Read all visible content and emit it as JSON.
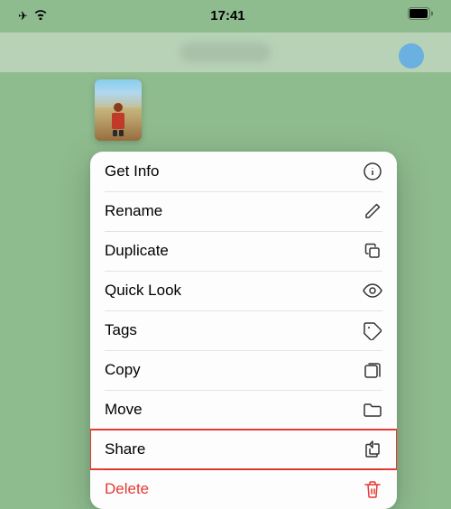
{
  "statusBar": {
    "time": "17:41",
    "signal": "✈",
    "wifi": "wifi",
    "battery": "battery"
  },
  "menu": {
    "items": [
      {
        "id": "get-info",
        "label": "Get Info",
        "icon": "info"
      },
      {
        "id": "rename",
        "label": "Rename",
        "icon": "pencil"
      },
      {
        "id": "duplicate",
        "label": "Duplicate",
        "icon": "duplicate"
      },
      {
        "id": "quick-look",
        "label": "Quick Look",
        "icon": "eye"
      },
      {
        "id": "tags",
        "label": "Tags",
        "icon": "tag"
      },
      {
        "id": "copy",
        "label": "Copy",
        "icon": "copy"
      },
      {
        "id": "move",
        "label": "Move",
        "icon": "folder"
      },
      {
        "id": "share",
        "label": "Share",
        "icon": "share",
        "highlighted": true
      },
      {
        "id": "delete",
        "label": "Delete",
        "icon": "trash",
        "destructive": true
      }
    ]
  },
  "colors": {
    "accent": "#e53935",
    "background": "#8fbc8f",
    "menuBg": "rgba(255,255,255,0.97)"
  }
}
